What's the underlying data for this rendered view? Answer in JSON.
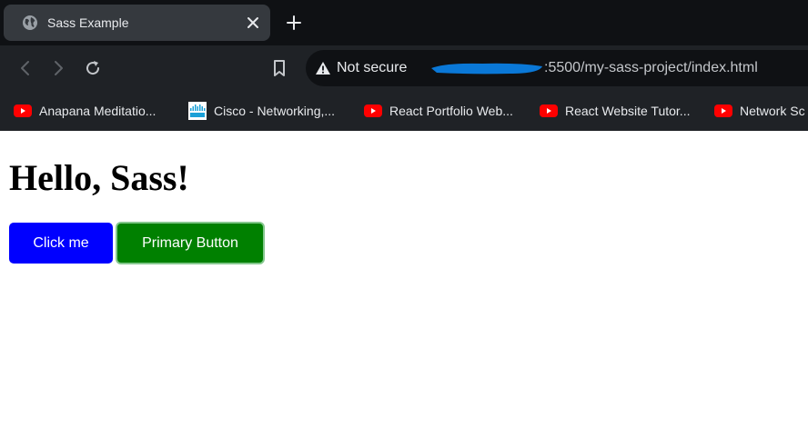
{
  "browser": {
    "tab": {
      "title": "Sass Example",
      "favicon": "globe-icon"
    },
    "toolbar": {
      "security_label": "Not secure",
      "url_visible": ":5500/my-sass-project/index.html",
      "redaction_color": "#0a78d7"
    },
    "bookmarks": [
      {
        "label": "Anapana Meditatio...",
        "icon": "youtube-icon"
      },
      {
        "label": "Cisco - Networking,...",
        "icon": "cisco-icon"
      },
      {
        "label": "React Portfolio Web...",
        "icon": "youtube-icon"
      },
      {
        "label": "React Website Tutor...",
        "icon": "youtube-icon"
      },
      {
        "label": "Network Sc",
        "icon": "youtube-icon"
      }
    ]
  },
  "page": {
    "heading": "Hello, Sass!",
    "buttons": [
      {
        "label": "Click me",
        "color": "#0000ff"
      },
      {
        "label": "Primary Button",
        "color": "#008000"
      }
    ]
  }
}
